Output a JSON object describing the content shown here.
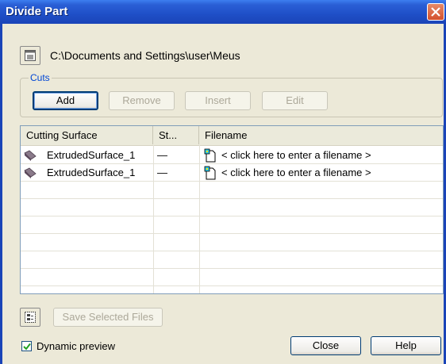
{
  "window": {
    "title": "Divide Part"
  },
  "path": {
    "text": "C:\\Documents and Settings\\user\\Meus"
  },
  "cuts": {
    "group_label": "Cuts",
    "buttons": {
      "add": "Add",
      "remove": "Remove",
      "insert": "Insert",
      "edit": "Edit"
    }
  },
  "table": {
    "columns": [
      "Cutting Surface",
      "St...",
      "Filename"
    ],
    "rows": [
      {
        "surface": "ExtrudedSurface_1",
        "status": "—",
        "filename": "< click here to enter a filename >"
      },
      {
        "surface": "ExtrudedSurface_1",
        "status": "—",
        "filename": "< click here to enter a filename >"
      }
    ]
  },
  "footer": {
    "save_selected": "Save Selected Files",
    "dynamic_preview": "Dynamic preview",
    "dynamic_preview_checked": true,
    "close": "Close",
    "help": "Help"
  },
  "icons": {
    "surface_icon": "extruded-surface-icon",
    "file_icon": "part-file-icon",
    "path_icon": "folder-browse-icon",
    "select_icon": "select-tree-icon"
  }
}
